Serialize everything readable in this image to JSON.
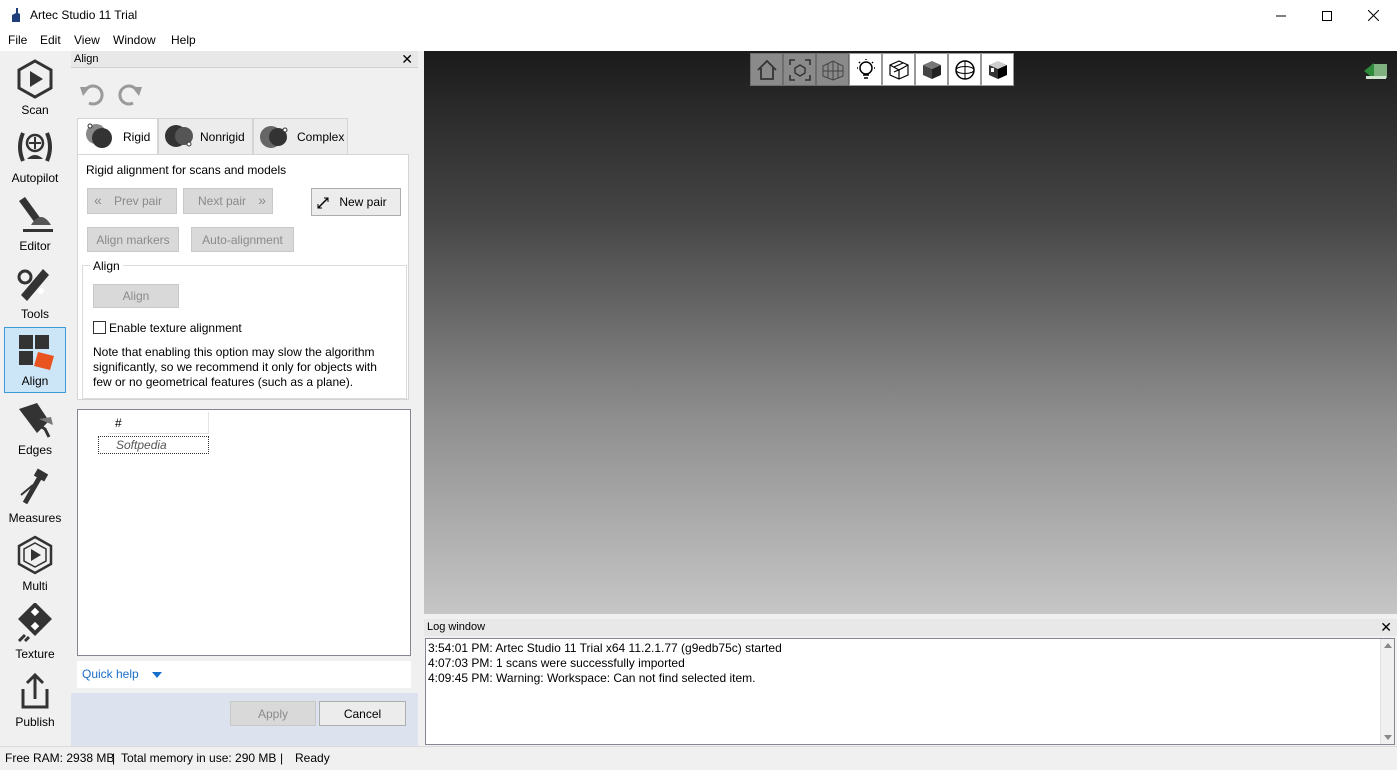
{
  "window": {
    "title": "Artec Studio 11 Trial"
  },
  "menu": [
    "File",
    "Edit",
    "View",
    "Window",
    "Help"
  ],
  "toolbar": {
    "items": [
      {
        "label": "Scan",
        "icon": "scan-icon"
      },
      {
        "label": "Autopilot",
        "icon": "autopilot-icon"
      },
      {
        "label": "Editor",
        "icon": "editor-icon"
      },
      {
        "label": "Tools",
        "icon": "tools-icon"
      },
      {
        "label": "Align",
        "icon": "align-icon",
        "active": true
      },
      {
        "label": "Edges",
        "icon": "edges-icon"
      },
      {
        "label": "Measures",
        "icon": "measures-icon"
      },
      {
        "label": "Multi",
        "icon": "multi-icon"
      },
      {
        "label": "Texture",
        "icon": "texture-icon"
      },
      {
        "label": "Publish",
        "icon": "publish-icon"
      }
    ]
  },
  "panel": {
    "title": "Align",
    "close": "✕",
    "tabs": [
      {
        "label": "Rigid",
        "selected": true
      },
      {
        "label": "Nonrigid"
      },
      {
        "label": "Complex"
      }
    ],
    "description": "Rigid alignment for scans and models",
    "buttons": {
      "prev_pair": "Prev pair",
      "next_pair": "Next pair",
      "new_pair": "New pair",
      "align_markers": "Align markers",
      "auto_alignment": "Auto-alignment"
    },
    "group": {
      "title": "Align",
      "align_button": "Align",
      "checkbox_label": "Enable texture alignment",
      "checkbox_checked": false,
      "note": "Note that enabling this option may slow the algorithm significantly, so we recommend it only for objects with few or no geometrical features (such as a plane)."
    },
    "list": {
      "column_header": "#",
      "rows": [
        "Softpedia"
      ]
    },
    "quick_help": "Quick help",
    "apply": "Apply",
    "cancel": "Cancel"
  },
  "viewport_buttons": [
    "home-icon",
    "fit-view-icon",
    "grid-icon",
    "light-icon",
    "wireframe-icon",
    "solid-cube-icon",
    "sphere-icon",
    "textured-cube-icon"
  ],
  "log": {
    "title": "Log window",
    "close": "✕",
    "lines": [
      "3:54:01 PM: Artec Studio 11 Trial x64 11.2.1.77 (g9edb75c) started",
      "4:07:03 PM: 1 scans were successfully imported",
      "4:09:45 PM: Warning: Workspace: Can not find selected item."
    ]
  },
  "status": {
    "free_ram": "Free RAM: 2938 MB",
    "total_memory": "Total memory in use: 290 MB",
    "state": "Ready",
    "sep": "|"
  },
  "colors": {
    "accent": "#3d9bd8",
    "active_tool_bg": "#cde6f7",
    "link": "#1a6fc9"
  }
}
